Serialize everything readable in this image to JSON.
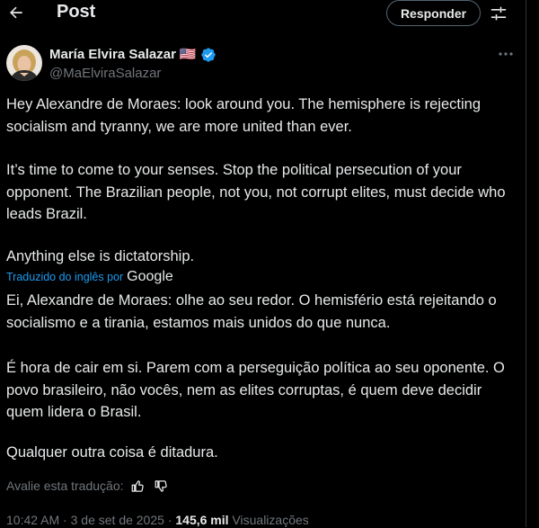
{
  "header": {
    "title": "Post",
    "reply_button": "Responder"
  },
  "author": {
    "name": "María Elvira Salazar",
    "flag": "🇺🇸",
    "handle": "@MaElviraSalazar"
  },
  "tweet": {
    "original": [
      "Hey Alexandre de Moraes: look around you. The hemisphere is rejecting socialism and tyranny, we are more united than ever.",
      "It’s time to come to your senses. Stop the political persecution of your opponent. The Brazilian people, not you, not corrupt elites, must decide who leads Brazil.",
      "Anything else is dictatorship."
    ],
    "translated_by": "Traduzido do inglês por",
    "translator": "Google",
    "translation": [
      "Ei, Alexandre de Moraes: olhe ao seu redor. O hemisfério está rejeitando o socialismo e a tirania, estamos mais unidos do que nunca.",
      "É hora de cair em si. Parem com a perseguição política ao seu oponente. O povo brasileiro, não vocês, nem as elites corruptas, é quem deve decidir quem lidera o Brasil.",
      "Qualquer outra coisa é ditadura."
    ],
    "rate_translation": "Avalie esta tradução:"
  },
  "meta": {
    "time": "10:42 AM",
    "separator": "·",
    "date": "3 de set de 2025",
    "views_count": "145,6 mil",
    "views_label": "Visualizações"
  },
  "colors": {
    "background": "#000000",
    "text": "#e7e9ea",
    "muted": "#71767b",
    "accent": "#1d9bf0"
  },
  "icons": {
    "back": "arrow-left-icon",
    "filter": "sliders-icon",
    "verified": "verified-badge-icon",
    "more": "more-dots-icon",
    "thumbs_up": "thumbs-up-icon",
    "thumbs_down": "thumbs-down-icon"
  }
}
